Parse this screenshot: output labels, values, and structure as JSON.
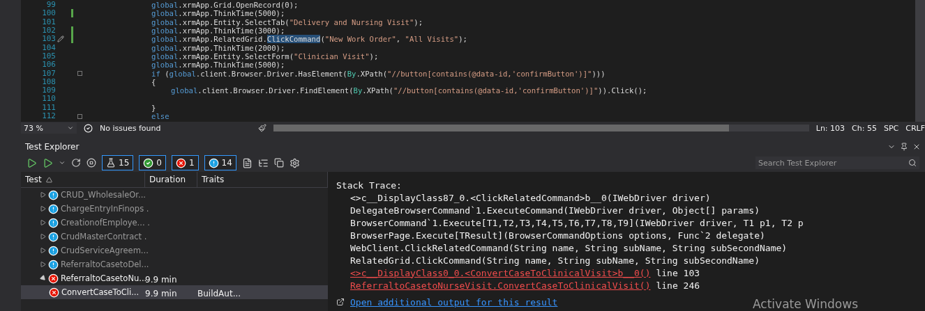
{
  "editor": {
    "lines": [
      {
        "number": "99",
        "changed": false,
        "fold": false,
        "nested": false,
        "tokens": [
          {
            "text": "global",
            "kind": "keyword"
          },
          {
            "text": ".xrmApp.Grid.OpenRecord(0);",
            "kind": "plain"
          }
        ]
      },
      {
        "number": "100",
        "changed": true,
        "fold": false,
        "nested": false,
        "tokens": [
          {
            "text": "global",
            "kind": "keyword"
          },
          {
            "text": ".xrmApp.ThinkTime(5000);",
            "kind": "plain"
          }
        ]
      },
      {
        "number": "101",
        "changed": false,
        "fold": false,
        "nested": false,
        "tokens": [
          {
            "text": "global",
            "kind": "keyword"
          },
          {
            "text": ".xrmApp.Entity.SelectTab(",
            "kind": "plain"
          },
          {
            "text": "\"Delivery and Nursing Visit\"",
            "kind": "string"
          },
          {
            "text": ");",
            "kind": "plain"
          }
        ]
      },
      {
        "number": "102",
        "changed": true,
        "fold": false,
        "nested": false,
        "tokens": [
          {
            "text": "global",
            "kind": "keyword"
          },
          {
            "text": ".xrmApp.ThinkTime(3000);",
            "kind": "plain"
          }
        ]
      },
      {
        "number": "103",
        "changed": true,
        "fold": false,
        "nested": false,
        "quick_action": true,
        "tokens": [
          {
            "text": "global",
            "kind": "keyword"
          },
          {
            "text": ".xrmApp.RelatedGrid.",
            "kind": "plain"
          },
          {
            "text": "ClickCommand",
            "kind": "selection"
          },
          {
            "text": "(",
            "kind": "plain"
          },
          {
            "text": "\"New Work Order\"",
            "kind": "string"
          },
          {
            "text": ", ",
            "kind": "plain"
          },
          {
            "text": "\"All Visits\"",
            "kind": "string"
          },
          {
            "text": ");",
            "kind": "plain"
          }
        ]
      },
      {
        "number": "104",
        "changed": false,
        "fold": false,
        "nested": false,
        "tokens": [
          {
            "text": "global",
            "kind": "keyword"
          },
          {
            "text": ".xrmApp.ThinkTime(2000);",
            "kind": "plain"
          }
        ]
      },
      {
        "number": "105",
        "changed": false,
        "fold": false,
        "nested": false,
        "tokens": [
          {
            "text": "global",
            "kind": "keyword"
          },
          {
            "text": ".xrmApp.Entity.SelectForm(",
            "kind": "plain"
          },
          {
            "text": "\"Clinician Visit\"",
            "kind": "string"
          },
          {
            "text": ");",
            "kind": "plain"
          }
        ]
      },
      {
        "number": "106",
        "changed": false,
        "fold": false,
        "nested": false,
        "tokens": [
          {
            "text": "global",
            "kind": "keyword"
          },
          {
            "text": ".xrmApp.ThinkTime(5000);",
            "kind": "plain"
          }
        ]
      },
      {
        "number": "107",
        "changed": false,
        "fold": true,
        "nested": false,
        "tokens": [
          {
            "text": "if",
            "kind": "keyword"
          },
          {
            "text": " (",
            "kind": "plain"
          },
          {
            "text": "global",
            "kind": "keyword"
          },
          {
            "text": ".client.Browser.Driver.HasElement(",
            "kind": "plain"
          },
          {
            "text": "By",
            "kind": "type"
          },
          {
            "text": ".XPath(",
            "kind": "plain"
          },
          {
            "text": "\"//button[contains(@data-id,'confirmButton')]\"",
            "kind": "string"
          },
          {
            "text": ")))",
            "kind": "plain"
          }
        ]
      },
      {
        "number": "108",
        "changed": false,
        "fold": false,
        "nested": false,
        "tokens": [
          {
            "text": "{",
            "kind": "plain"
          }
        ]
      },
      {
        "number": "109",
        "changed": false,
        "fold": false,
        "nested": true,
        "tokens": [
          {
            "text": "global",
            "kind": "keyword"
          },
          {
            "text": ".client.Browser.Driver.FindElement(",
            "kind": "plain"
          },
          {
            "text": "By",
            "kind": "type"
          },
          {
            "text": ".XPath(",
            "kind": "plain"
          },
          {
            "text": "\"//button[contains(@data-id,'confirmButton')]\"",
            "kind": "string"
          },
          {
            "text": ")).Click();",
            "kind": "plain"
          }
        ]
      },
      {
        "number": "110",
        "changed": false,
        "fold": false
      },
      {
        "number": "111",
        "changed": false,
        "fold": false,
        "nested": false,
        "tokens": [
          {
            "text": "}",
            "kind": "plain"
          }
        ]
      },
      {
        "number": "112",
        "changed": false,
        "fold": true,
        "nested": false,
        "tokens": [
          {
            "text": "else",
            "kind": "keyword"
          }
        ]
      }
    ],
    "status_bar": {
      "zoom": "73 %",
      "issues": "No issues found",
      "line": "Ln: 103",
      "column": "Ch: 55",
      "indent": "SPC",
      "line_ending": "CRLF"
    }
  },
  "test_explorer": {
    "title": "Test Explorer",
    "search": {
      "placeholder": "Search Test Explorer"
    },
    "counters": [
      {
        "kind": "total",
        "count": "15"
      },
      {
        "kind": "passed",
        "count": "0"
      },
      {
        "kind": "failed",
        "count": "1"
      },
      {
        "kind": "not_run",
        "count": "14"
      }
    ],
    "columns": [
      "Test",
      "Duration",
      "Traits"
    ],
    "tests": [
      {
        "name": "CRUD_WholesaleOr...",
        "kind": "not_run",
        "expanded": false,
        "selected": false
      },
      {
        "name": "ChargeEntryInFinops .",
        "kind": "not_run",
        "expanded": false,
        "selected": false
      },
      {
        "name": "CreationofEmploye... .",
        "kind": "not_run",
        "expanded": false,
        "selected": false
      },
      {
        "name": "CrudMasterContract .",
        "kind": "not_run",
        "expanded": false,
        "selected": false
      },
      {
        "name": "CrudServiceAgreem...",
        "kind": "not_run",
        "expanded": false,
        "selected": false
      },
      {
        "name": "ReferraltoCasetoDel...",
        "kind": "not_run",
        "expanded": false,
        "selected": false
      },
      {
        "name": "ReferraltoCasetoNu...",
        "kind": "failed",
        "expanded": true,
        "selected": false,
        "duration": "9.9 min",
        "children": [
          {
            "name": "ConvertCaseToCli...",
            "kind": "failed",
            "selected": true,
            "duration": "9.9 min",
            "traits": "BuildAut..."
          }
        ]
      }
    ],
    "details": {
      "heading": "Stack Trace:",
      "frames": [
        {
          "text": "<>c__DisplayClass87_0.<ClickRelatedCommand>b__0(IWebDriver driver)",
          "link": false
        },
        {
          "text": "DelegateBrowserCommand`1.ExecuteCommand(IWebDriver driver, Object[] params)",
          "link": false
        },
        {
          "text": "BrowserCommand`1.Execute[T1,T2,T3,T4,T5,T6,T7,T8,T9](IWebDriver driver, T1 p1, T2 p",
          "link": false
        },
        {
          "text": "BrowserPage.Execute[TResult](BrowserCommandOptions options, Func`2 delegate)",
          "link": false
        },
        {
          "text": "WebClient.ClickRelatedCommand(String name, String subName, String subSecondName)",
          "link": false
        },
        {
          "text": "RelatedGrid.ClickCommand(String name, String subName, String subSecondName)",
          "link": false
        },
        {
          "text": "<>c__DisplayClass0_0.<ConvertCaseToClinicalVisit>b__0()",
          "link": true,
          "suffix": "line 103"
        },
        {
          "text": "ReferraltoCasetoNurseVisit.ConvertCaseToClinicalVisit()",
          "link": true,
          "suffix": "line 246"
        }
      ],
      "more_output": "Open additional output for this result"
    }
  },
  "overlay": {
    "text": "Activate Windows"
  }
}
